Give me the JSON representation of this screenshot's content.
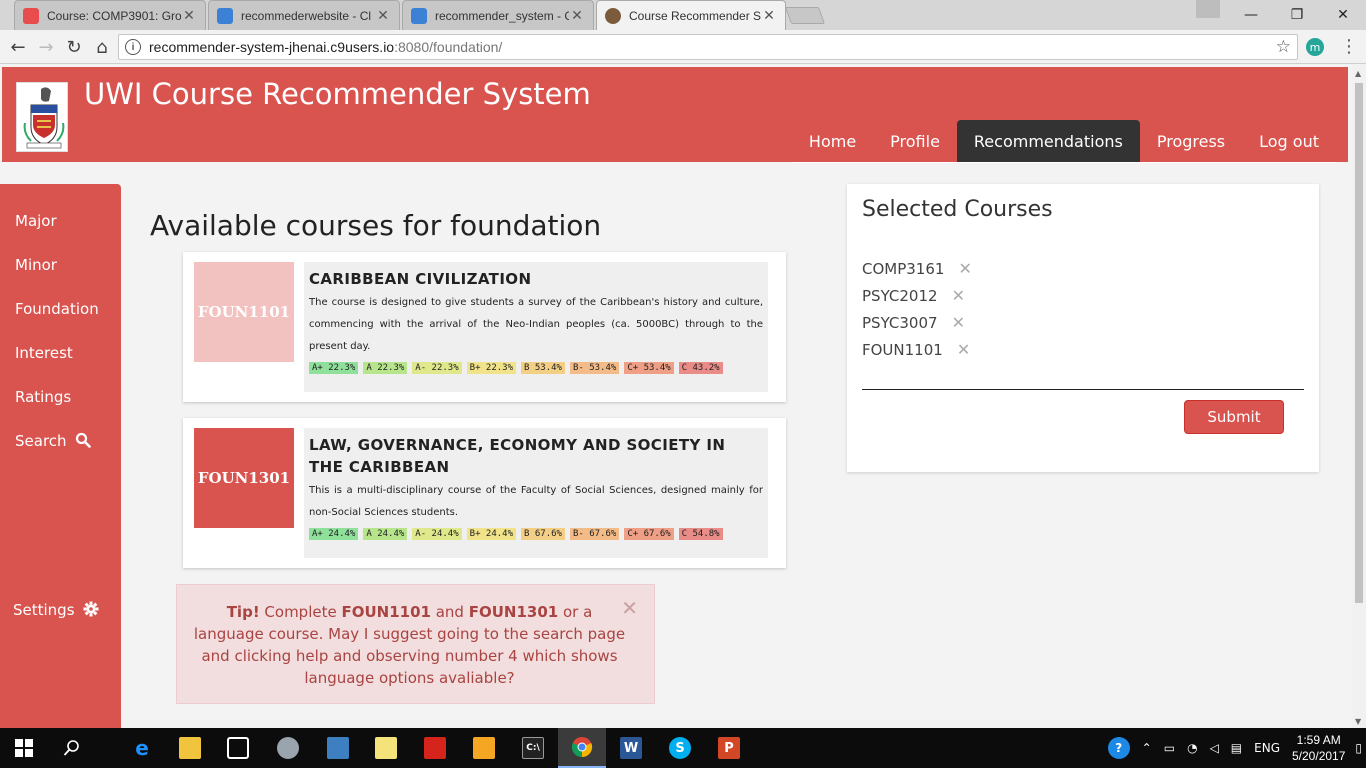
{
  "browser": {
    "tabs": [
      {
        "title": "Course: COMP3901: Gro",
        "favicon_color": "#e84c4c",
        "active": false
      },
      {
        "title": "recommederwebsite - Cl",
        "favicon_color": "#3b82d6",
        "active": false
      },
      {
        "title": "recommender_system - C",
        "favicon_color": "#3b82d6",
        "active": false
      },
      {
        "title": "Course Recommender Sy",
        "favicon_color": "#7a5c3c",
        "active": true
      }
    ],
    "url_host": "recommender-system-jhenai.c9users.io",
    "url_path": ":8080/foundation/",
    "extension_letter": "m"
  },
  "site": {
    "title": "UWI Course Recommender System",
    "nav": [
      {
        "label": "Home",
        "active": false
      },
      {
        "label": "Profile",
        "active": false
      },
      {
        "label": "Recommendations",
        "active": true
      },
      {
        "label": "Progress",
        "active": false
      },
      {
        "label": "Log out",
        "active": false
      }
    ]
  },
  "sidebar": {
    "items": [
      {
        "label": "Major"
      },
      {
        "label": "Minor"
      },
      {
        "label": "Foundation"
      },
      {
        "label": "Interest"
      },
      {
        "label": "Ratings"
      },
      {
        "label": "Search"
      }
    ],
    "settings_label": "Settings"
  },
  "main": {
    "heading": "Available courses for foundation",
    "courses": [
      {
        "code": "FOUN1101",
        "code_color": "#f2c2c0",
        "title": "CARIBBEAN CIVILIZATION",
        "description": "The course is designed to give students a survey of the Caribbean's history and culture, commencing with the arrival of the Neo-Indian peoples (ca. 5000BC) through to the present day.",
        "grades": [
          "A+ 22.3%",
          "A 22.3%",
          "A- 22.3%",
          "B+ 22.3%",
          "B 53.4%",
          "B- 53.4%",
          "C+ 53.4%",
          "C 43.2%"
        ]
      },
      {
        "code": "FOUN1301",
        "code_color": "#d9534f",
        "title": "LAW, GOVERNANCE, ECONOMY AND SOCIETY IN THE CARIBBEAN",
        "description": "This is a multi-disciplinary course of the Faculty of Social Sciences, designed mainly for non-Social Sciences students.",
        "grades": [
          "A+ 24.4%",
          "A 24.4%",
          "A- 24.4%",
          "B+ 24.4%",
          "B 67.6%",
          "B- 67.6%",
          "C+ 67.6%",
          "C 54.8%"
        ]
      }
    ],
    "grade_colors": [
      "#8ee09a",
      "#b7e58c",
      "#dfe88a",
      "#f1e38a",
      "#f3cf86",
      "#f2bb87",
      "#ef9f86",
      "#e98b86"
    ],
    "tip": {
      "prefix": "Tip!",
      "text1": " Complete ",
      "code1": "FOUN1101",
      "text2": " and ",
      "code2": "FOUN1301",
      "text3": " or a language course. May I suggest going to the search page and clicking help and observing number 4 which shows language options avaliable?"
    }
  },
  "selected": {
    "title": "Selected Courses",
    "items": [
      "COMP3161",
      "PSYC2012",
      "PSYC3007",
      "FOUN1101"
    ],
    "submit_label": "Submit"
  },
  "taskbar": {
    "language": "ENG",
    "time": "1:59 AM",
    "date": "5/20/2017"
  }
}
